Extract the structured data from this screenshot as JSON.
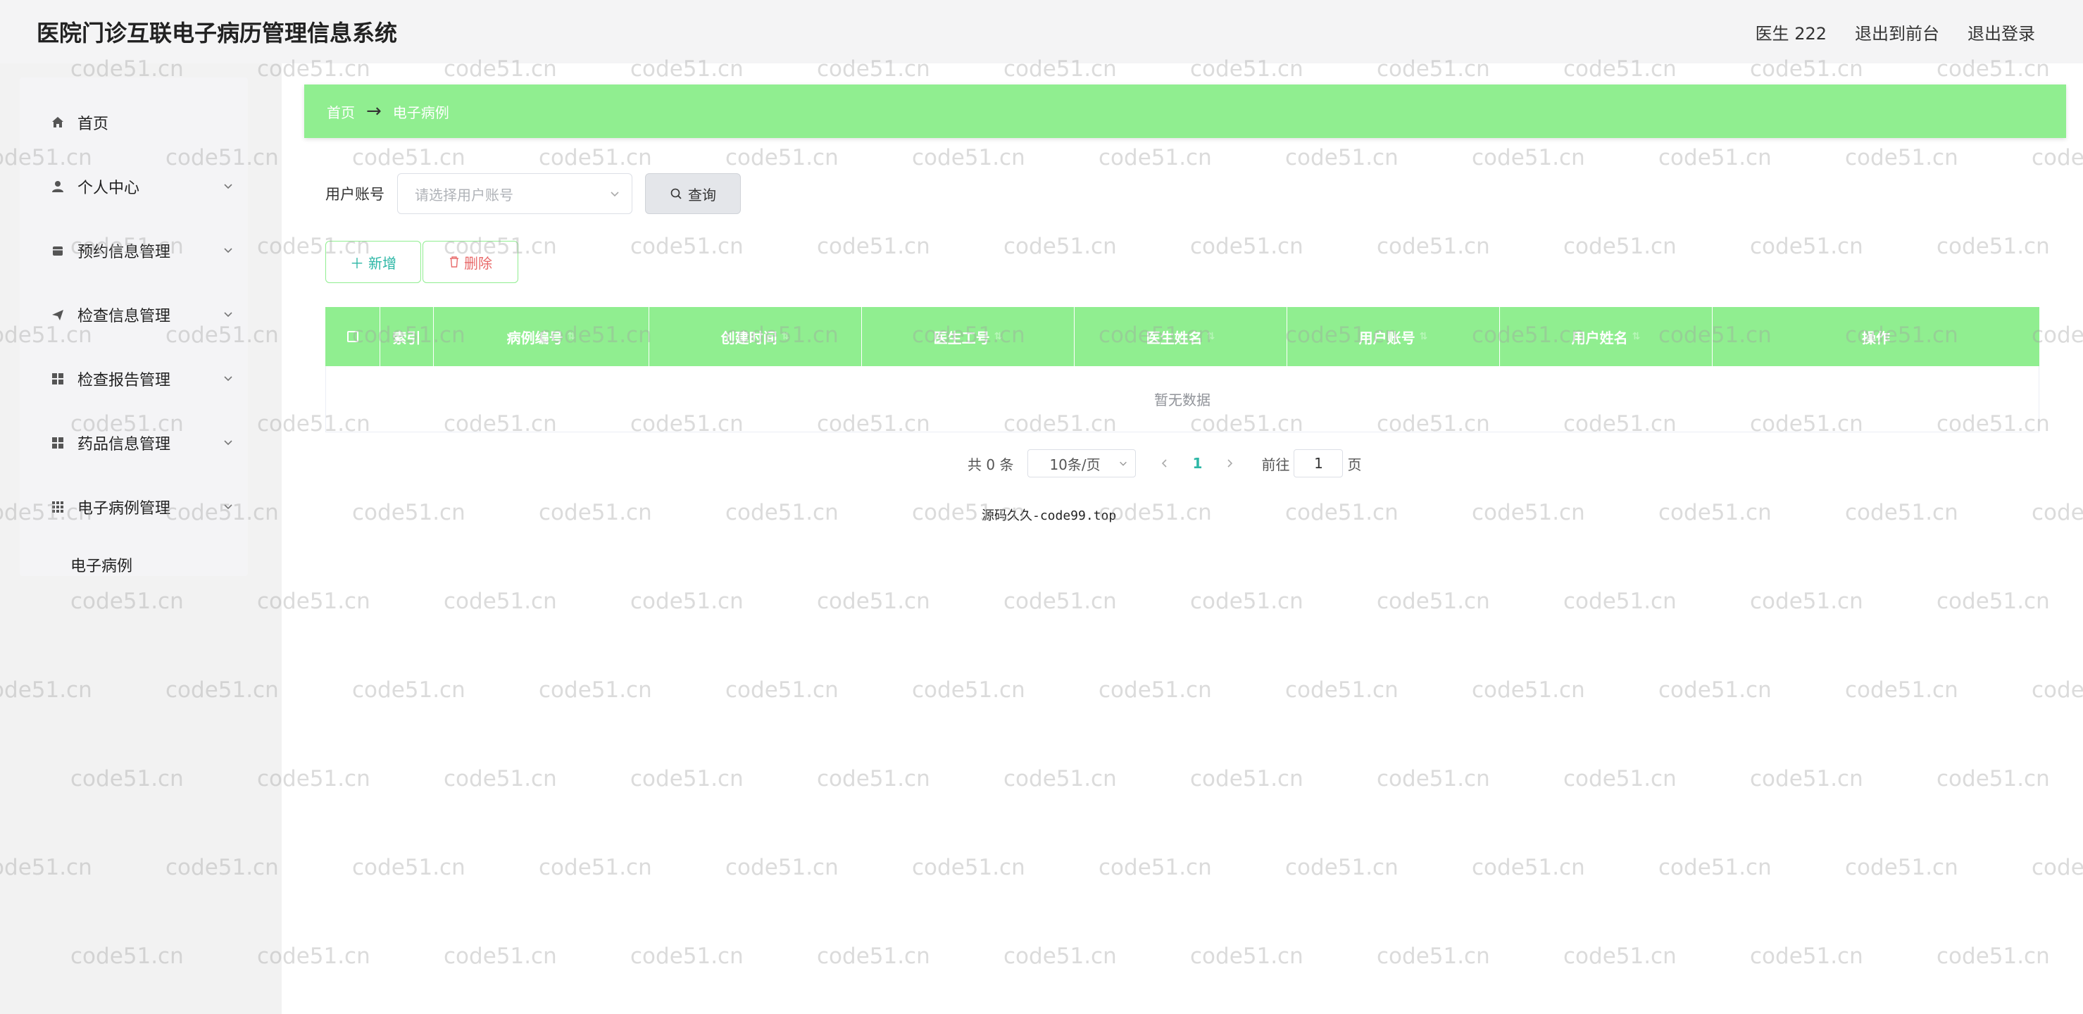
{
  "header": {
    "title": "医院门诊互联电子病历管理信息系统",
    "user": "医生 222",
    "to_frontend": "退出到前台",
    "logout": "退出登录"
  },
  "sidebar": {
    "items": [
      {
        "label": "首页",
        "icon": "home-icon"
      },
      {
        "label": "个人中心",
        "icon": "user-icon"
      },
      {
        "label": "预约信息管理",
        "icon": "calendar-icon"
      },
      {
        "label": "检查信息管理",
        "icon": "send-icon"
      },
      {
        "label": "检查报告管理",
        "icon": "grid-icon"
      },
      {
        "label": "药品信息管理",
        "icon": "grid-icon"
      },
      {
        "label": "电子病例管理",
        "icon": "apps-icon"
      }
    ],
    "subitem": "电子病例"
  },
  "breadcrumb": {
    "home": "首页",
    "separator": "→",
    "current": "电子病例"
  },
  "search": {
    "label": "用户账号",
    "placeholder": "请选择用户账号",
    "query_button": "查询"
  },
  "actions": {
    "add": "新增",
    "delete": "删除"
  },
  "table": {
    "columns": [
      "",
      "索引",
      "病例编号",
      "创建时间",
      "医生工号",
      "医生姓名",
      "用户账号",
      "用户姓名",
      "操作"
    ],
    "empty_text": "暂无数据"
  },
  "pagination": {
    "total": "共 0 条",
    "page_size": "10条/页",
    "current_page": "1",
    "goto_label": "前往",
    "goto_value": "1",
    "page_suffix": "页"
  },
  "footer_text": "源码久久-code99.top",
  "watermark_text": "code51.cn",
  "colors": {
    "accent": "#90ee90",
    "teal": "#2db7a6",
    "danger": "#e86a6a"
  }
}
